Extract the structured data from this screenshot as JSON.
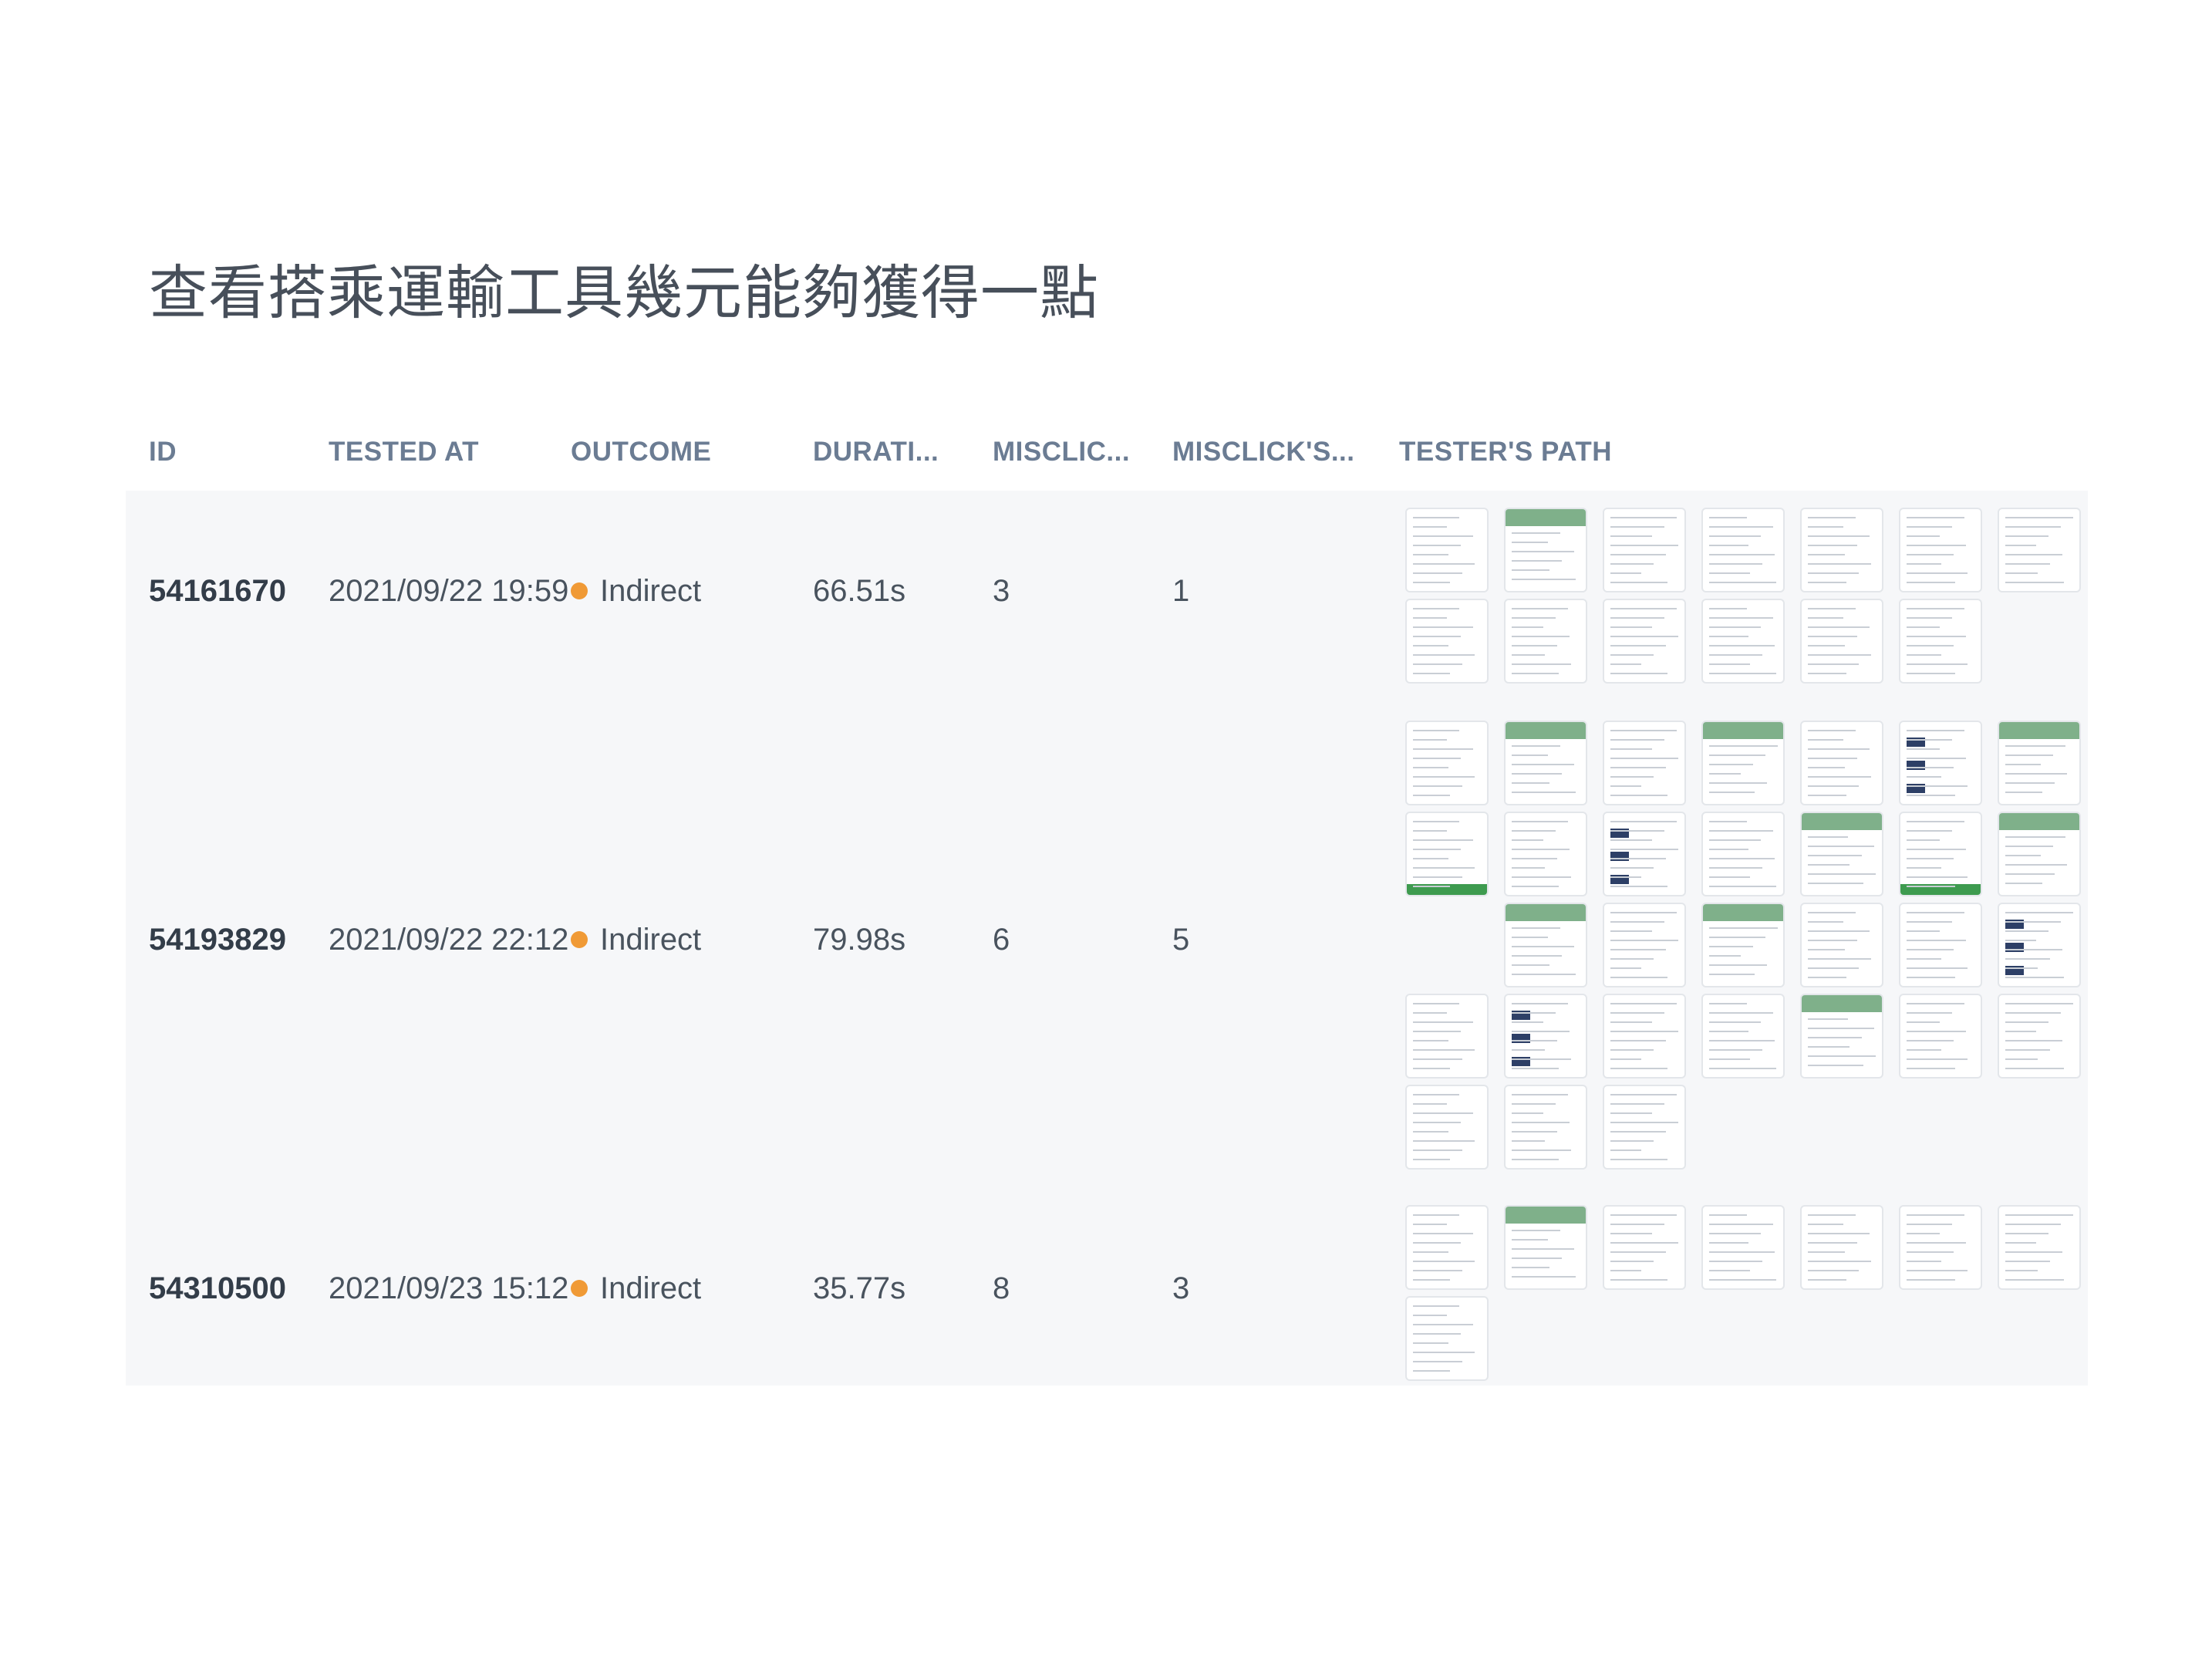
{
  "page": {
    "title": "查看搭乘運輸工具幾元能夠獲得一點"
  },
  "columns": [
    "ID",
    "TESTED AT",
    "OUTCOME",
    "DURATI...",
    "MISCLIC...",
    "MISCLICK'S...",
    "TESTER'S PATH"
  ],
  "rows": [
    {
      "id": "54161670",
      "tested_at": "2021/09/22 19:59",
      "outcome": "Indirect",
      "duration": "66.51s",
      "misclicks": "3",
      "misclick_s": "1"
    },
    {
      "id": "54193829",
      "tested_at": "2021/09/22 22:12",
      "outcome": "Indirect",
      "duration": "79.98s",
      "misclicks": "6",
      "misclick_s": "5"
    },
    {
      "id": "54310500",
      "tested_at": "2021/09/23 15:12",
      "outcome": "Indirect",
      "duration": "35.77s",
      "misclicks": "8",
      "misclick_s": "3"
    }
  ],
  "colors": {
    "indirect_dot": "#f09a36",
    "header_text": "#6b7c93",
    "row_background": "#f6f7f9"
  },
  "icons": {
    "outcome": "status-dot-icon"
  }
}
